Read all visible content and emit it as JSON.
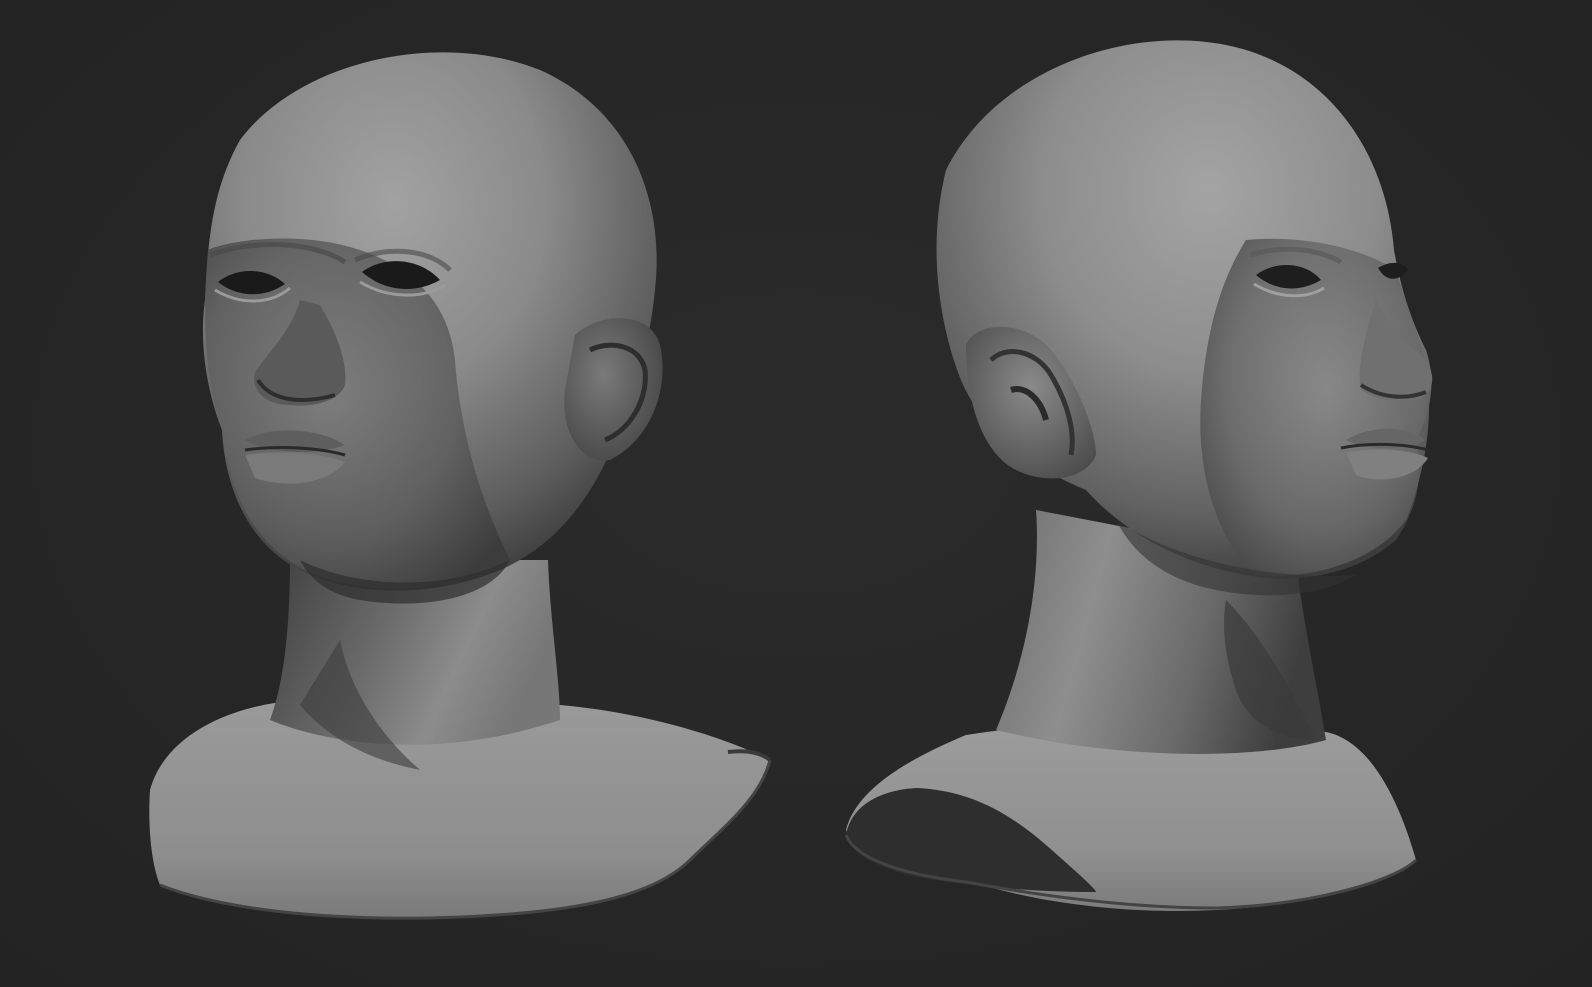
{
  "scene": {
    "background_color": "#272727",
    "material_color": "#8a8a8a",
    "views": [
      {
        "view": "three-quarter-left",
        "subject": "bust-sculpt-icon"
      },
      {
        "view": "three-quarter-right",
        "subject": "bust-sculpt-icon"
      }
    ]
  }
}
